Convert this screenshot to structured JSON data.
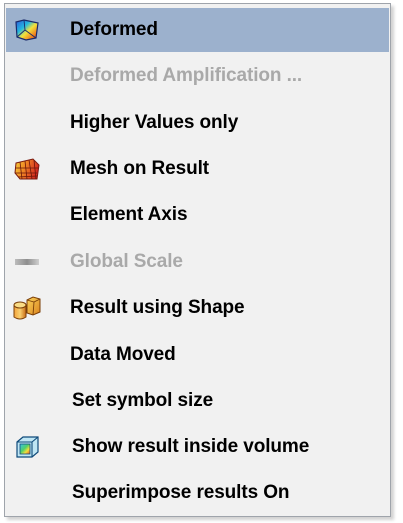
{
  "menu": {
    "items": [
      {
        "label": "Deformed",
        "icon": "deformed-shape-icon",
        "state": "highlighted"
      },
      {
        "label": "Deformed Amplification ...",
        "icon": "",
        "state": "disabled"
      },
      {
        "label": "Higher Values only",
        "icon": "",
        "state": "enabled"
      },
      {
        "label": "Mesh on Result",
        "icon": "mesh-result-icon",
        "state": "enabled"
      },
      {
        "label": "Element Axis",
        "icon": "",
        "state": "enabled"
      },
      {
        "label": "Global Scale",
        "icon": "global-scale-icon",
        "state": "disabled"
      },
      {
        "label": "Result using Shape",
        "icon": "result-shape-icon",
        "state": "enabled"
      },
      {
        "label": "Data Moved",
        "icon": "",
        "state": "enabled"
      },
      {
        "label": "Set symbol size",
        "icon": "",
        "state": "enabled"
      },
      {
        "label": "Show result inside volume",
        "icon": "volume-cube-icon",
        "state": "enabled"
      },
      {
        "label": "Superimpose results On",
        "icon": "",
        "state": "enabled"
      }
    ]
  },
  "colors": {
    "highlight": "#9cb1cd",
    "menu_background": "#f1f1f1",
    "disabled_text": "#a9a9a9",
    "text": "#000000"
  }
}
